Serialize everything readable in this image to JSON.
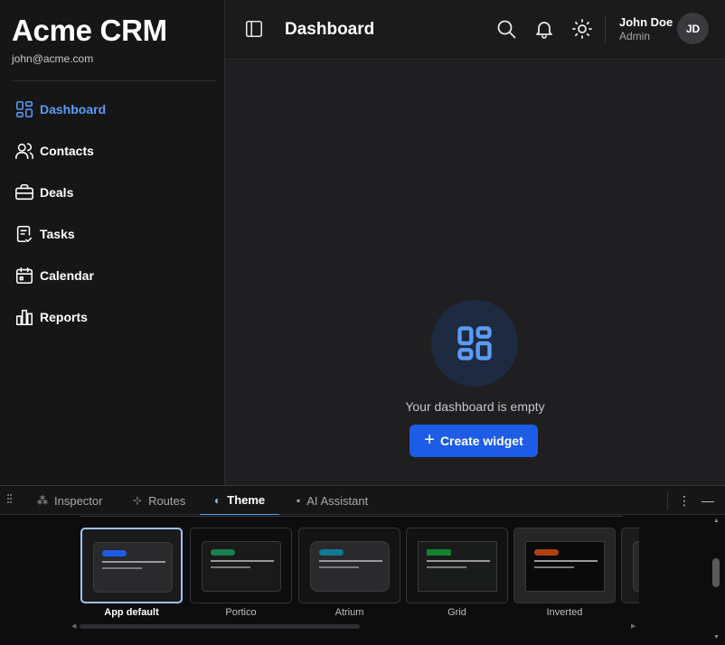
{
  "sidebar": {
    "brand": "Acme CRM",
    "email": "john@acme.com",
    "items": [
      {
        "label": "Dashboard",
        "icon": "dashboard-icon",
        "active": true
      },
      {
        "label": "Contacts",
        "icon": "users-icon"
      },
      {
        "label": "Deals",
        "icon": "briefcase-icon"
      },
      {
        "label": "Tasks",
        "icon": "clipboard-check-icon"
      },
      {
        "label": "Calendar",
        "icon": "calendar-icon"
      },
      {
        "label": "Reports",
        "icon": "bar-chart-icon"
      }
    ]
  },
  "header": {
    "title": "Dashboard",
    "user_name": "John Doe",
    "user_role": "Admin",
    "avatar_initials": "JD"
  },
  "main": {
    "empty_text": "Your dashboard is empty",
    "create_button_label": "Create widget",
    "accent": "#1d5ce6"
  },
  "devtools": {
    "tabs": [
      {
        "label": "Inspector",
        "icon": "hierarchy-icon"
      },
      {
        "label": "Routes",
        "icon": "signpost-icon"
      },
      {
        "label": "Theme",
        "icon": "palette-icon",
        "active": true
      },
      {
        "label": "AI Assistant",
        "icon": "chat-icon"
      }
    ],
    "themes": [
      {
        "label": "App default",
        "accent": "#1d5ce6",
        "selected": true
      },
      {
        "label": "Portico",
        "accent": "#16804f"
      },
      {
        "label": "Atrium",
        "accent": "#0e7a96"
      },
      {
        "label": "Grid",
        "accent": "#15812e"
      },
      {
        "label": "Inverted",
        "accent": "#b0410f"
      }
    ]
  }
}
